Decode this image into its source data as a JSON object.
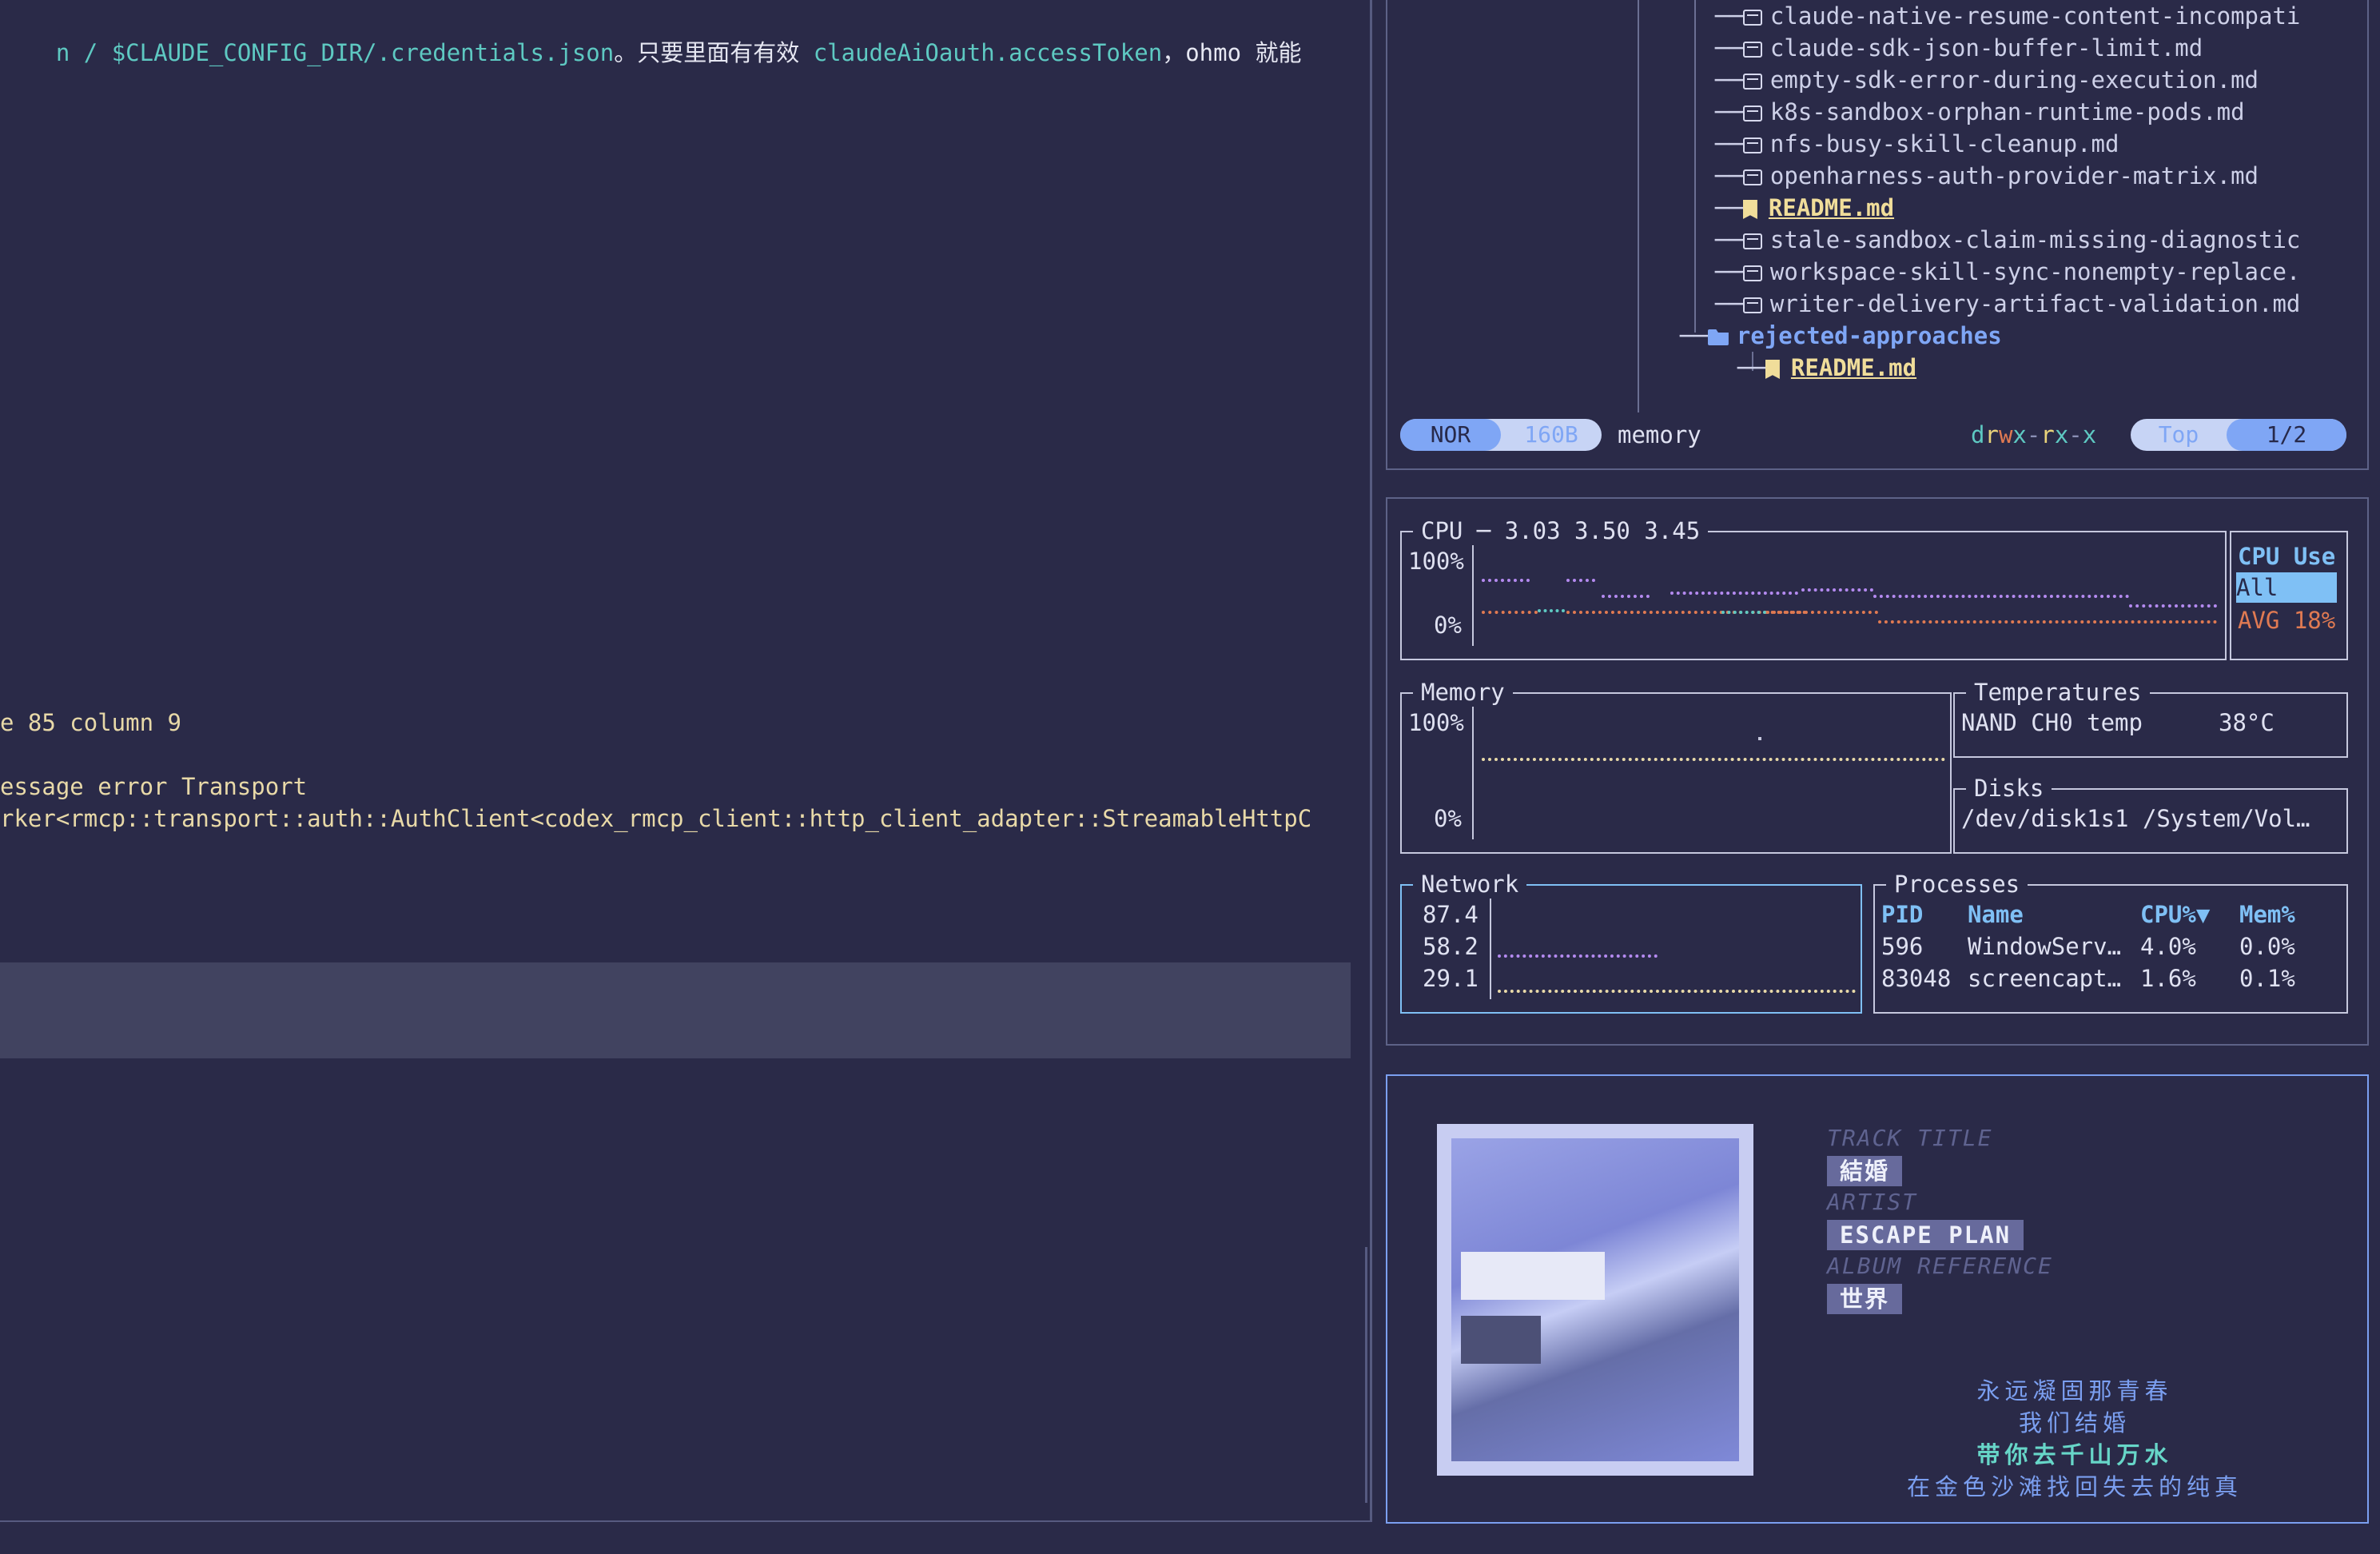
{
  "left": {
    "top_line": {
      "seg1": "n / ",
      "seg2": "$CLAUDE_CONFIG_DIR/.credentials.json",
      "seg3": "。只要里面有有效 ",
      "seg4": "claudeAiOauth.accessToken",
      "seg5": "，ohmo 就能"
    },
    "line_85": "e 85 column 9",
    "err_line1": "essage error Transport",
    "err_line2": "rker<rmcp::transport::auth::AuthClient<codex_rmcp_client::http_client_adapter::StreamableHttpC"
  },
  "tree": {
    "files": [
      "claude-native-resume-content-incompati",
      "claude-sdk-json-buffer-limit.md",
      "empty-sdk-error-during-execution.md",
      "k8s-sandbox-orphan-runtime-pods.md",
      "nfs-busy-skill-cleanup.md",
      "openharness-auth-provider-matrix.md",
      "README.md",
      "stale-sandbox-claim-missing-diagnostic",
      "workspace-skill-sync-nonempty-replace.",
      "writer-delivery-artifact-validation.md"
    ],
    "folder": "rejected-approaches",
    "folder_file": "README.md"
  },
  "status": {
    "mode": "NOR",
    "size": "160B",
    "name": "memory",
    "perm": {
      "d": "d",
      "r1": "r",
      "w": "w",
      "x1": "x",
      "dash1": "-",
      "r2": "r",
      "x2": "x",
      "dash2": "-",
      "x3": "x"
    },
    "pos": "Top",
    "page": "1/2"
  },
  "btop": {
    "cpu_title": "CPU ─ 3.03 3.50 3.45",
    "cpu_100": "100%",
    "cpu_0": "0%",
    "cpu_use_title": "CPU Use",
    "cpu_use_all": "All",
    "cpu_use_avg": "AVG 18%",
    "mem_title": "Memory",
    "mem_100": "100%",
    "mem_0": "0%",
    "temp_title": "Temperatures",
    "temp_name": "NAND CH0 temp",
    "temp_value": "38°C",
    "disks_title": "Disks",
    "disk_row": "/dev/disk1s1 /System/Vol…",
    "net_title": "Network",
    "net_ticks": [
      "87.4",
      "58.2",
      "29.1"
    ],
    "proc_title": "Processes",
    "proc_headers": [
      "PID",
      "Name",
      "CPU%▼",
      "Mem%"
    ],
    "proc_rows": [
      [
        "596",
        "WindowServ…",
        "4.0%",
        "0.0%"
      ],
      [
        "83048",
        "screencapt…",
        "1.6%",
        "0.1%"
      ]
    ]
  },
  "music": {
    "track_label": "TRACK TITLE",
    "track": "結婚",
    "artist_label": "ARTIST",
    "artist": "ESCAPE PLAN",
    "album_label": "ALBUM REFERENCE",
    "album": "世界",
    "lyrics": [
      "永远凝固那青春",
      "我们结婚",
      "带你去千山万水",
      "在金色沙滩找回失去的纯真"
    ]
  },
  "colors": {
    "background": "#2a2a48",
    "cyan": "#5ec9c2",
    "accent_blue": "#7fa6f5",
    "readme_yellow": "#f0dd9a",
    "cpu_purple": "#b48af0",
    "cpu_orange": "#e07a52",
    "lyric_blue": "#7b9ff0",
    "lyric_current": "#67d6c8"
  }
}
